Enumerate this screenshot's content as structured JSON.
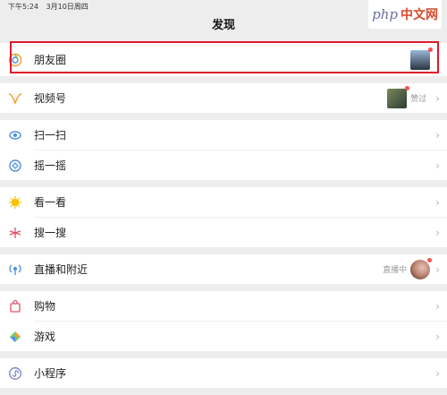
{
  "status_bar": {
    "time": "下午5:24",
    "date": "3月10日周四"
  },
  "page": {
    "title": "发现"
  },
  "watermark": {
    "php": "php",
    "cn": "中文网"
  },
  "groups": [
    {
      "items": [
        {
          "label": "朋友圈",
          "icon": "moments-icon"
        }
      ]
    },
    {
      "items": [
        {
          "label": "视频号",
          "icon": "channels-icon",
          "side_text": "赞过"
        }
      ]
    },
    {
      "items": [
        {
          "label": "扫一扫",
          "icon": "scan-icon"
        },
        {
          "label": "摇一摇",
          "icon": "shake-icon"
        }
      ]
    },
    {
      "items": [
        {
          "label": "看一看",
          "icon": "top-stories-icon"
        },
        {
          "label": "搜一搜",
          "icon": "search-icon"
        }
      ]
    },
    {
      "items": [
        {
          "label": "直播和附近",
          "icon": "live-icon",
          "side_text": "直播中"
        }
      ]
    },
    {
      "items": [
        {
          "label": "购物",
          "icon": "shopping-bag-icon"
        },
        {
          "label": "游戏",
          "icon": "game-icon"
        }
      ]
    },
    {
      "items": [
        {
          "label": "小程序",
          "icon": "mini-program-icon"
        }
      ]
    }
  ],
  "colors": {
    "highlight": "#e0192b",
    "badge": "#fa5151",
    "background": "#ededed"
  }
}
